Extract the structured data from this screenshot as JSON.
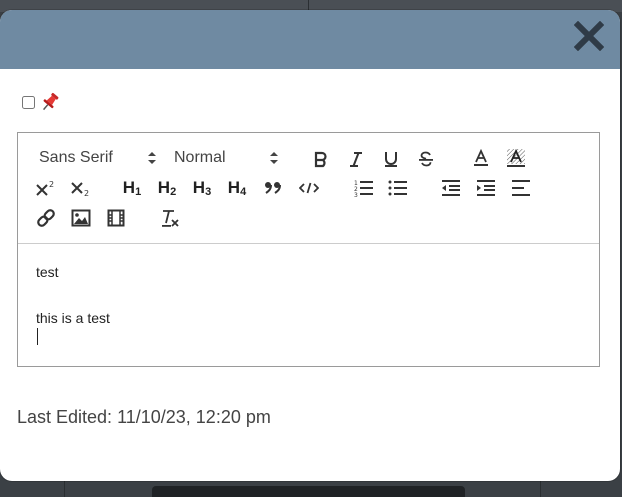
{
  "note_modal": {
    "close_icon": "close-icon",
    "pin_icon": "pushpin-icon",
    "pinned": false,
    "toolbar": {
      "font_family": "Sans Serif",
      "font_size": "Normal",
      "buttons": [
        "bold-icon",
        "italic-icon",
        "underline-icon",
        "strikethrough-icon",
        "font-color-icon",
        "background-color-icon",
        "superscript-icon",
        "subscript-icon",
        "heading-1-icon",
        "heading-2-icon",
        "heading-3-icon",
        "heading-4-icon",
        "blockquote-icon",
        "code-block-icon",
        "ordered-list-icon",
        "bullet-list-icon",
        "outdent-icon",
        "indent-icon",
        "align-icon",
        "link-icon",
        "image-icon",
        "video-icon",
        "clear-formatting-icon"
      ],
      "h1": "H",
      "h1_sub": "1",
      "h2": "H",
      "h2_sub": "2",
      "h3": "H",
      "h3_sub": "3",
      "h4": "H",
      "h4_sub": "4"
    },
    "content": {
      "line1": "test",
      "line2": "this is a test"
    },
    "last_edited": "Last Edited: 11/10/23, 12:20 pm"
  }
}
